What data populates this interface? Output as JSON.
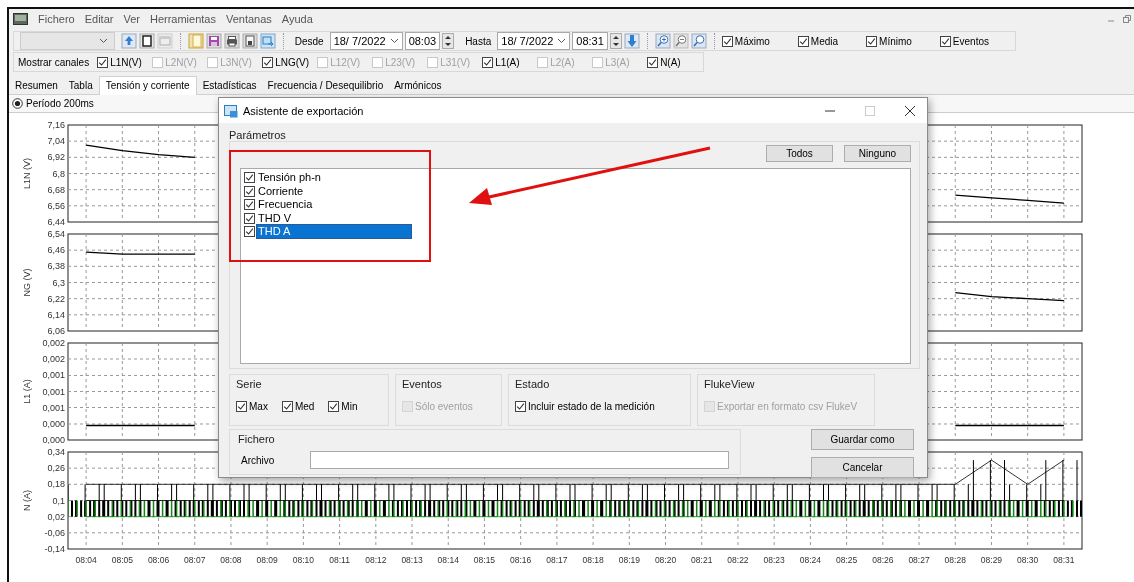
{
  "menu": [
    "Fichero",
    "Editar",
    "Ver",
    "Herramientas",
    "Ventanas",
    "Ayuda"
  ],
  "toolbar": {
    "from": {
      "label": "Desde",
      "date": "18/ 7/2022",
      "time": "08:03"
    },
    "to": {
      "label": "Hasta",
      "date": "18/ 7/2022",
      "time": "08:31"
    },
    "options": [
      {
        "label": "Máximo",
        "checked": true
      },
      {
        "label": "Media",
        "checked": true
      },
      {
        "label": "Mínimo",
        "checked": true
      },
      {
        "label": "Eventos",
        "checked": true
      }
    ]
  },
  "channels": {
    "label": "Mostrar canales",
    "items": [
      {
        "label": "L1N(V)",
        "checked": true
      },
      {
        "label": "L2N(V)",
        "checked": false
      },
      {
        "label": "L3N(V)",
        "checked": false
      },
      {
        "label": "LNG(V)",
        "checked": true
      },
      {
        "label": "L12(V)",
        "checked": false
      },
      {
        "label": "L23(V)",
        "checked": false
      },
      {
        "label": "L31(V)",
        "checked": false
      },
      {
        "label": "L1(A)",
        "checked": true
      },
      {
        "label": "L2(A)",
        "checked": false
      },
      {
        "label": "L3(A)",
        "checked": false
      },
      {
        "label": "N(A)",
        "checked": true
      }
    ]
  },
  "tabs": [
    {
      "label": "Resumen",
      "selected": false
    },
    {
      "label": "Tabla",
      "selected": false
    },
    {
      "label": "Tensión y corriente",
      "selected": true
    },
    {
      "label": "Estadísticas",
      "selected": false
    },
    {
      "label": "Frecuencia / Desequilibrio",
      "selected": false
    },
    {
      "label": "Armónicos",
      "selected": false
    }
  ],
  "period": {
    "label": "Período 200ms",
    "selected": true
  },
  "charts": [
    {
      "chart_data": {
        "type": "line",
        "ylabel": "L1N (V)",
        "grid": true,
        "ylim": [
          6.44,
          7.16
        ],
        "yticks": [
          {
            "value": 7.16,
            "label": "7,16"
          },
          {
            "value": 7.04,
            "label": "7,04"
          },
          {
            "value": 6.92,
            "label": "6,92"
          },
          {
            "value": 6.8,
            "label": "6,8"
          },
          {
            "value": 6.68,
            "label": "6,68"
          },
          {
            "value": 6.56,
            "label": "6,56"
          },
          {
            "value": 6.44,
            "label": "6,44"
          }
        ],
        "categories": [
          null,
          null,
          null,
          null,
          null,
          null,
          null,
          null,
          null,
          null,
          null,
          null,
          null,
          null,
          null,
          null,
          null,
          null,
          null,
          null,
          null,
          null,
          null,
          null,
          null,
          null,
          null,
          null
        ],
        "values": [
          7.01,
          6.97,
          6.94,
          6.92,
          null,
          null,
          null,
          null,
          null,
          null,
          null,
          null,
          null,
          null,
          null,
          null,
          null,
          null,
          null,
          null,
          null,
          null,
          null,
          null,
          6.64,
          6.62,
          6.6,
          6.58
        ]
      }
    },
    {
      "chart_data": {
        "type": "line",
        "ylabel": "NG (V)",
        "grid": true,
        "ylim": [
          6.06,
          6.54
        ],
        "yticks": [
          {
            "value": 6.54,
            "label": "6,54"
          },
          {
            "value": 6.46,
            "label": "6,46"
          },
          {
            "value": 6.38,
            "label": "6,38"
          },
          {
            "value": 6.3,
            "label": "6,3"
          },
          {
            "value": 6.22,
            "label": "6,22"
          },
          {
            "value": 6.14,
            "label": "6,14"
          },
          {
            "value": 6.06,
            "label": "6,06"
          }
        ],
        "categories": [
          null,
          null,
          null,
          null,
          null,
          null,
          null,
          null,
          null,
          null,
          null,
          null,
          null,
          null,
          null,
          null,
          null,
          null,
          null,
          null,
          null,
          null,
          null,
          null,
          null,
          null,
          null,
          null
        ],
        "values": [
          6.45,
          6.44,
          6.44,
          6.44,
          null,
          null,
          null,
          null,
          null,
          null,
          null,
          null,
          null,
          null,
          null,
          null,
          null,
          null,
          null,
          null,
          null,
          null,
          null,
          null,
          6.25,
          6.23,
          6.22,
          6.21
        ]
      }
    },
    {
      "chart_data": {
        "type": "line",
        "ylabel": "L1 (A)",
        "grid": true,
        "ylim": [
          0,
          0.002
        ],
        "yticks": [
          {
            "value": 0.002,
            "label": "0,002"
          },
          {
            "value": 0.00167,
            "label": "0,002"
          },
          {
            "value": 0.00133,
            "label": "0,001"
          },
          {
            "value": 0.001,
            "label": "0,001"
          },
          {
            "value": 0.00067,
            "label": "0,001"
          },
          {
            "value": 0.00033,
            "label": "0,000"
          },
          {
            "value": 0,
            "label": "0,000"
          }
        ],
        "categories": [
          null,
          null,
          null,
          null,
          null,
          null,
          null,
          null,
          null,
          null,
          null,
          null,
          null,
          null,
          null,
          null,
          null,
          null,
          null,
          null,
          null,
          null,
          null,
          null,
          null,
          null,
          null,
          null
        ],
        "values": [
          0.0003,
          0.0003,
          0.0003,
          0.0003,
          null,
          null,
          null,
          null,
          null,
          null,
          null,
          null,
          null,
          null,
          null,
          null,
          null,
          null,
          null,
          null,
          null,
          null,
          null,
          null,
          0.0003,
          0.0003,
          0.0003,
          0.0003
        ]
      }
    },
    {
      "chart_data": {
        "type": "line",
        "ylabel": "N (A)",
        "grid": true,
        "ylim": [
          -0.14,
          0.34
        ],
        "yticks": [
          {
            "value": 0.34,
            "label": "0,34"
          },
          {
            "value": 0.26,
            "label": "0,26"
          },
          {
            "value": 0.18,
            "label": "0,18"
          },
          {
            "value": 0.1,
            "label": "0,1"
          },
          {
            "value": 0.02,
            "label": "0,02"
          },
          {
            "value": -0.06,
            "label": "-0,06"
          },
          {
            "value": -0.14,
            "label": "-0,14"
          }
        ],
        "categories": [
          "08:04",
          "08:05",
          "08:06",
          "08:07",
          "08:08",
          "08:09",
          "08:10",
          "08:11",
          "08:12",
          "08:13",
          "08:14",
          "08:15",
          "08:16",
          "08:17",
          "08:18",
          "08:19",
          "08:20",
          "08:21",
          "08:22",
          "08:23",
          "08:24",
          "08:25",
          "08:26",
          "08:27",
          "08:28",
          "08:29",
          "08:30",
          "08:31"
        ],
        "series": [
          {
            "color": "#000000",
            "values": [
              0.18,
              0.18,
              0.18,
              0.18,
              0.18,
              0.18,
              0.18,
              0.18,
              0.18,
              0.18,
              0.18,
              0.18,
              0.18,
              0.18,
              0.18,
              0.18,
              0.18,
              0.18,
              0.18,
              0.18,
              0.18,
              0.18,
              0.18,
              0.18,
              0.18,
              0.3,
              0.18,
              0.3
            ]
          },
          {
            "color": "#000000",
            "values": [
              0.1,
              0.1,
              0.1,
              0.1,
              0.1,
              0.1,
              0.1,
              0.1,
              0.1,
              0.1,
              0.1,
              0.1,
              0.1,
              0.1,
              0.1,
              0.1,
              0.1,
              0.1,
              0.1,
              0.1,
              0.1,
              0.1,
              0.1,
              0.1,
              0.1,
              0.1,
              0.1,
              0.1
            ]
          },
          {
            "color": "#118811",
            "values": [
              0.02,
              0.02,
              0.02,
              0.02,
              0.02,
              0.02,
              0.02,
              0.02,
              0.02,
              0.02,
              0.02,
              0.02,
              0.02,
              0.02,
              0.02,
              0.02,
              0.02,
              0.02,
              0.02,
              0.02,
              0.02,
              0.02,
              0.02,
              0.02,
              0.02,
              0.02,
              0.02,
              0.02
            ]
          }
        ]
      }
    }
  ],
  "dialog": {
    "title": "Asistente de exportación",
    "parameters": {
      "title": "Parámetros",
      "buttons": [
        "Todos",
        "Ninguno"
      ],
      "items": [
        {
          "label": "Tensión ph-n",
          "checked": true,
          "selected": false
        },
        {
          "label": "Corriente",
          "checked": true,
          "selected": false
        },
        {
          "label": "Frecuencia",
          "checked": true,
          "selected": false
        },
        {
          "label": "THD V",
          "checked": true,
          "selected": false
        },
        {
          "label": "THD A",
          "checked": true,
          "selected": true
        }
      ]
    },
    "groups": [
      {
        "title": "Serie",
        "options": [
          {
            "label": "Max",
            "checked": true,
            "disabled": false
          },
          {
            "label": "Med",
            "checked": true,
            "disabled": false
          },
          {
            "label": "Min",
            "checked": true,
            "disabled": false
          }
        ]
      },
      {
        "title": "Eventos",
        "options": [
          {
            "label": "Sólo eventos",
            "checked": false,
            "disabled": true
          }
        ]
      },
      {
        "title": "Estado",
        "options": [
          {
            "label": "Incluir estado de la medición",
            "checked": true,
            "disabled": false
          }
        ]
      },
      {
        "title": "FlukeView",
        "options": [
          {
            "label": "Exportar en formato csv FlukeV",
            "checked": false,
            "disabled": true
          }
        ]
      }
    ],
    "file": {
      "title": "Fichero",
      "label": "Archivo"
    },
    "actions": [
      "Guardar como",
      "Cancelar"
    ]
  }
}
